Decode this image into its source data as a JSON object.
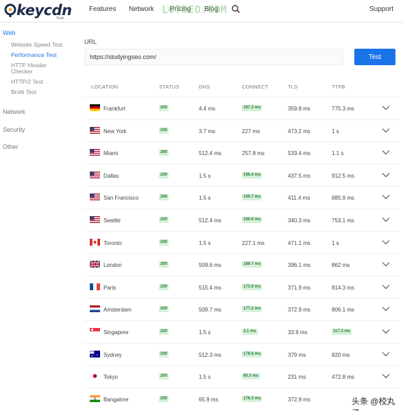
{
  "header": {
    "logo_text": "keycdn",
    "logo_sub": "Tools",
    "nav": [
      "Features",
      "Network",
      "Pricing",
      "Blog"
    ],
    "support": "Support",
    "watermark": "LOTSEO.COM"
  },
  "sidebar": {
    "sections": [
      "Web",
      "Network",
      "Security",
      "Other"
    ],
    "web_items": [
      "Website Speed Test",
      "Performance Test",
      "HTTP Header Checker",
      "HTTP/2 Test",
      "Brotli Test"
    ]
  },
  "form": {
    "url_label": "URL",
    "url_value": "https://studyingseo.com/",
    "test_label": "Test"
  },
  "table": {
    "headers": [
      "LOCATION",
      "STATUS",
      "DNS",
      "CONNECT",
      "TLS",
      "TTFB"
    ],
    "rows": [
      {
        "flag": "de",
        "location": "Frankfurt",
        "status": "200",
        "dns": "4.4 ms",
        "connect": "167.3 ms",
        "connect_badge": true,
        "tls": "359.8 ms",
        "ttfb": "775.3 ms",
        "ttfb_badge": false
      },
      {
        "flag": "us",
        "location": "New York",
        "status": "200",
        "dns": "3.7 ms",
        "connect": "227 ms",
        "connect_badge": false,
        "tls": "473.2 ms",
        "ttfb": "1 s",
        "ttfb_badge": false
      },
      {
        "flag": "us",
        "location": "Miami",
        "status": "200",
        "dns": "512.4 ms",
        "connect": "257.8 ms",
        "connect_badge": false,
        "tls": "533.4 ms",
        "ttfb": "1.1 s",
        "ttfb_badge": false
      },
      {
        "flag": "us",
        "location": "Dallas",
        "status": "200",
        "dns": "1.5 s",
        "connect": "196.4 ms",
        "connect_badge": true,
        "tls": "437.5 ms",
        "ttfb": "912.5 ms",
        "ttfb_badge": false
      },
      {
        "flag": "us",
        "location": "San Francisco",
        "status": "200",
        "dns": "1.5 s",
        "connect": "195.7 ms",
        "connect_badge": true,
        "tls": "411.4 ms",
        "ttfb": "885.9 ms",
        "ttfb_badge": false
      },
      {
        "flag": "us",
        "location": "Seattle",
        "status": "200",
        "dns": "512.4 ms",
        "connect": "160.6 ms",
        "connect_badge": true,
        "tls": "340.3 ms",
        "ttfb": "753.1 ms",
        "ttfb_badge": false
      },
      {
        "flag": "ca",
        "location": "Toronto",
        "status": "200",
        "dns": "1.5 s",
        "connect": "227.1 ms",
        "connect_badge": false,
        "tls": "471.1 ms",
        "ttfb": "1 s",
        "ttfb_badge": false
      },
      {
        "flag": "gb",
        "location": "London",
        "status": "200",
        "dns": "509.6 ms",
        "connect": "189.7 ms",
        "connect_badge": true,
        "tls": "396.1 ms",
        "ttfb": "862 ms",
        "ttfb_badge": false
      },
      {
        "flag": "fr",
        "location": "Paris",
        "status": "200",
        "dns": "515.4 ms",
        "connect": "173.9 ms",
        "connect_badge": true,
        "tls": "371.9 ms",
        "ttfb": "814.3 ms",
        "ttfb_badge": false
      },
      {
        "flag": "nl",
        "location": "Amsterdam",
        "status": "200",
        "dns": "509.7 ms",
        "connect": "177.2 ms",
        "connect_badge": true,
        "tls": "372.9 ms",
        "ttfb": "806.1 ms",
        "ttfb_badge": false
      },
      {
        "flag": "sg",
        "location": "Singapore",
        "status": "200",
        "dns": "1.5 s",
        "connect": "3.1 ms",
        "connect_badge": true,
        "tls": "33.9 ms",
        "ttfb": "117.3 ms",
        "ttfb_badge": true
      },
      {
        "flag": "au",
        "location": "Sydney",
        "status": "200",
        "dns": "512.3 ms",
        "connect": "179.8 ms",
        "connect_badge": true,
        "tls": "379 ms",
        "ttfb": "820 ms",
        "ttfb_badge": false
      },
      {
        "flag": "jp",
        "location": "Tokyo",
        "status": "200",
        "dns": "1.5 s",
        "connect": "80.3 ms",
        "connect_badge": true,
        "tls": "231 ms",
        "ttfb": "472.8 ms",
        "ttfb_badge": false
      },
      {
        "flag": "in",
        "location": "Bangalore",
        "status": "200",
        "dns": "65.9 ms",
        "connect": "176.3 ms",
        "connect_badge": true,
        "tls": "372.9 ms",
        "ttfb": "",
        "ttfb_badge": false
      }
    ]
  },
  "footer_watermark": "头条 @校丸子",
  "colors": {
    "accent": "#1a73e8",
    "badge_bg": "#d4f1d8",
    "badge_text": "#2d7a3a"
  }
}
